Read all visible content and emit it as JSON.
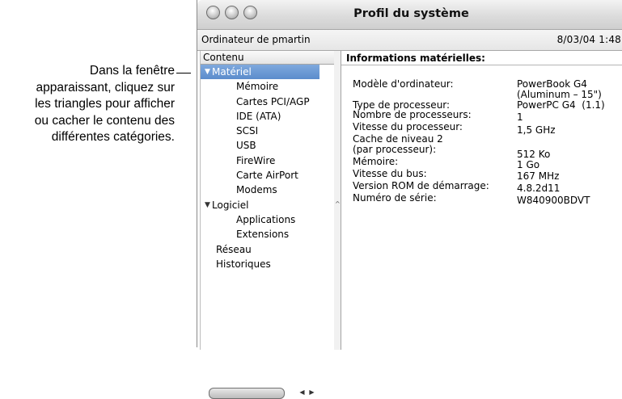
{
  "callout": {
    "line1": "Dans la fenêtre",
    "line2": "apparaissant, cliquez sur",
    "line3": "les triangles pour afficher",
    "line4": "ou cacher le contenu des",
    "line5": "différentes catégories."
  },
  "window": {
    "title": "Profil du système",
    "computer_name": "Ordinateur de pmartin",
    "datetime": "8/03/04 1:48"
  },
  "sidebar": {
    "header": "Contenu",
    "items": [
      {
        "label": "Matériel"
      },
      {
        "label": "Mémoire"
      },
      {
        "label": "Cartes PCI/AGP"
      },
      {
        "label": "IDE (ATA)"
      },
      {
        "label": "SCSI"
      },
      {
        "label": "USB"
      },
      {
        "label": "FireWire"
      },
      {
        "label": "Carte AirPort"
      },
      {
        "label": "Modems"
      },
      {
        "label": "Logiciel"
      },
      {
        "label": "Applications"
      },
      {
        "label": "Extensions"
      },
      {
        "label": "Réseau"
      },
      {
        "label": "Historiques"
      }
    ]
  },
  "content": {
    "header": "Informations matérielles:",
    "rows": [
      {
        "label": "Modèle d'ordinateur:",
        "value": "PowerBook G4\n(Aluminum – 15\")"
      },
      {
        "label": "Type de processeur:",
        "value": "PowerPC G4  (1.1)"
      },
      {
        "label": "Nombre de processeurs:",
        "value": "1"
      },
      {
        "label": "Vitesse du processeur:",
        "value": "1,5 GHz"
      },
      {
        "label": "Cache de niveau 2\n(par processeur):",
        "value": "512 Ko"
      },
      {
        "label": "Mémoire:",
        "value": "1 Go"
      },
      {
        "label": "Vitesse du bus:",
        "value": "167 MHz"
      },
      {
        "label": "Version ROM de démarrage:",
        "value": "4.8.2d11"
      },
      {
        "label": "Numéro de série:",
        "value": "W840900BDVT"
      }
    ]
  },
  "colors": {
    "selection": "#6a98d4",
    "titlebar": "#dcdcdc"
  },
  "icons": {
    "expanded_triangle": "▼",
    "collapse_marker": "^",
    "left_arrow": "◀",
    "right_arrow": "▶"
  }
}
